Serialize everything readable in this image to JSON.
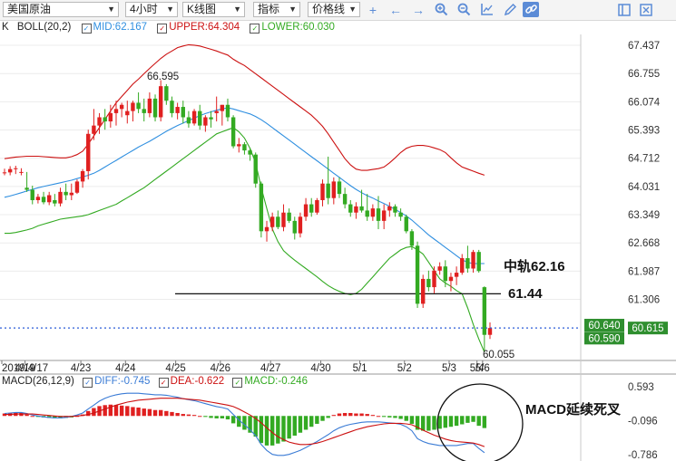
{
  "toolbar": {
    "product": "美国原油",
    "period": "4小时",
    "chart_type": "K线图",
    "indicator": "指标",
    "price_line": "价格线"
  },
  "indicator_bar": {
    "k": "K",
    "boll_label": "BOLL(20,2)",
    "mid": "MID:62.167",
    "upper": "UPPER:64.304",
    "lower": "LOWER:60.030"
  },
  "macd_bar": {
    "label": "MACD(26,12,9)",
    "diff": "DIFF:-0.745",
    "dea": "DEA:-0.622",
    "macd": "MACD:-0.246"
  },
  "colors": {
    "up": "#e02020",
    "down": "#33aa22",
    "mid": "#2f8fe0",
    "upper": "#cc1111",
    "lower": "#33aa22",
    "price_line": "#2a5bd7",
    "diff": "#3a7bd5",
    "dea": "#cc1111",
    "label_bg": "#2f8f2f"
  },
  "annotations": {
    "high_label": "66.595",
    "low_label": "60.055",
    "mid_rail": "中轨62.16",
    "support": "61.44",
    "macd_note": "MACD延续死叉"
  },
  "price_tags": {
    "upper": "60.640",
    "lower": "60.590",
    "current": "60.615"
  },
  "chart_data": {
    "type": "candlestick",
    "price_axis": [
      "67.437",
      "66.755",
      "66.074",
      "65.393",
      "64.712",
      "64.031",
      "63.349",
      "62.668",
      "61.987",
      "61.306",
      "60.625"
    ],
    "macd_axis": [
      "0.593",
      "-0.096",
      "-0.786"
    ],
    "x_labels": [
      "2019/4/17",
      "4/19",
      "4/23",
      "4/24",
      "4/25",
      "4/26",
      "4/27",
      "4/30",
      "5/1",
      "5/2",
      "5/3",
      "5/4",
      "5/6"
    ],
    "ohlc": [
      [
        64.35,
        64.46,
        64.3,
        64.37
      ],
      [
        64.37,
        64.52,
        64.3,
        64.45
      ],
      [
        64.45,
        64.53,
        64.33,
        64.47
      ],
      [
        64.36,
        64.47,
        64.3,
        64.38
      ],
      [
        64.0,
        64.38,
        63.9,
        63.95
      ],
      [
        63.95,
        64.05,
        63.6,
        63.7
      ],
      [
        63.7,
        63.85,
        63.62,
        63.78
      ],
      [
        63.78,
        63.9,
        63.6,
        63.65
      ],
      [
        63.65,
        63.9,
        63.58,
        63.82
      ],
      [
        63.7,
        63.85,
        63.55,
        63.62
      ],
      [
        63.62,
        64.0,
        63.55,
        63.9
      ],
      [
        63.9,
        64.1,
        63.7,
        63.82
      ],
      [
        63.82,
        64.1,
        63.7,
        63.88
      ],
      [
        63.88,
        64.2,
        63.85,
        64.15
      ],
      [
        64.15,
        64.45,
        64.0,
        64.4
      ],
      [
        64.4,
        65.4,
        64.2,
        65.3
      ],
      [
        65.3,
        65.9,
        65.15,
        65.5
      ],
      [
        65.5,
        65.8,
        65.3,
        65.7
      ],
      [
        65.7,
        65.9,
        65.4,
        65.6
      ],
      [
        65.6,
        66.0,
        65.45,
        65.8
      ],
      [
        65.8,
        66.1,
        65.5,
        65.9
      ],
      [
        65.9,
        66.05,
        65.7,
        66.0
      ],
      [
        65.75,
        66.1,
        65.55,
        65.85
      ],
      [
        65.85,
        66.1,
        65.6,
        66.05
      ],
      [
        66.05,
        66.3,
        65.8,
        65.9
      ],
      [
        65.9,
        66.15,
        65.6,
        65.8
      ],
      [
        65.8,
        66.3,
        65.7,
        66.15
      ],
      [
        66.15,
        66.25,
        65.6,
        65.7
      ],
      [
        65.7,
        66.595,
        65.6,
        66.45
      ],
      [
        66.45,
        66.5,
        66.0,
        66.1
      ],
      [
        66.1,
        66.2,
        65.7,
        65.8
      ],
      [
        65.8,
        66.05,
        65.65,
        65.95
      ],
      [
        65.95,
        66.1,
        65.55,
        65.7
      ],
      [
        65.7,
        65.85,
        65.45,
        65.55
      ],
      [
        65.55,
        65.9,
        65.5,
        65.85
      ],
      [
        65.85,
        66.0,
        65.4,
        65.5
      ],
      [
        65.5,
        65.75,
        65.35,
        65.7
      ],
      [
        65.7,
        65.85,
        65.45,
        65.65
      ],
      [
        65.8,
        66.2,
        65.6,
        65.85
      ],
      [
        65.85,
        66.0,
        65.5,
        66.0
      ],
      [
        66.0,
        66.15,
        65.6,
        65.7
      ],
      [
        65.7,
        65.75,
        64.95,
        65.0
      ],
      [
        65.0,
        65.2,
        64.85,
        65.05
      ],
      [
        65.05,
        65.1,
        64.8,
        64.9
      ],
      [
        64.9,
        64.95,
        64.65,
        64.8
      ],
      [
        64.8,
        64.85,
        64.0,
        64.1
      ],
      [
        64.1,
        64.15,
        62.8,
        62.95
      ],
      [
        62.95,
        63.2,
        62.7,
        63.05
      ],
      [
        63.05,
        63.4,
        62.95,
        63.3
      ],
      [
        63.3,
        63.45,
        63.0,
        63.05
      ],
      [
        63.05,
        63.6,
        62.95,
        63.4
      ],
      [
        63.4,
        63.5,
        63.15,
        63.2
      ],
      [
        63.2,
        63.3,
        62.75,
        62.9
      ],
      [
        62.9,
        63.4,
        62.8,
        63.3
      ],
      [
        63.3,
        63.75,
        63.2,
        63.6
      ],
      [
        63.6,
        63.75,
        63.3,
        63.4
      ],
      [
        63.4,
        63.75,
        63.35,
        63.7
      ],
      [
        63.7,
        64.2,
        63.55,
        64.1
      ],
      [
        64.1,
        64.75,
        63.6,
        63.75
      ],
      [
        63.75,
        64.25,
        63.6,
        64.15
      ],
      [
        64.15,
        64.25,
        63.75,
        63.85
      ],
      [
        63.85,
        64.0,
        63.5,
        63.6
      ],
      [
        63.6,
        63.7,
        63.3,
        63.4
      ],
      [
        63.4,
        63.65,
        63.25,
        63.55
      ],
      [
        63.55,
        63.95,
        63.4,
        63.45
      ],
      [
        63.45,
        63.85,
        63.2,
        63.3
      ],
      [
        63.3,
        63.6,
        63.2,
        63.5
      ],
      [
        63.5,
        63.8,
        63.0,
        63.2
      ],
      [
        63.2,
        63.6,
        63.0,
        63.45
      ],
      [
        63.45,
        63.65,
        63.3,
        63.55
      ],
      [
        63.55,
        63.6,
        63.3,
        63.4
      ],
      [
        63.4,
        63.5,
        63.2,
        63.3
      ],
      [
        63.3,
        63.35,
        62.9,
        62.95
      ],
      [
        62.95,
        63.0,
        62.5,
        62.6
      ],
      [
        62.6,
        62.7,
        61.1,
        61.2
      ],
      [
        61.2,
        61.9,
        61.1,
        61.8
      ],
      [
        61.8,
        62.0,
        61.5,
        61.6
      ],
      [
        61.6,
        62.1,
        61.45,
        62.0
      ],
      [
        62.0,
        62.2,
        61.9,
        62.1
      ],
      [
        62.1,
        62.25,
        61.6,
        61.75
      ],
      [
        61.75,
        61.95,
        61.5,
        61.85
      ],
      [
        61.85,
        62.1,
        61.65,
        61.95
      ],
      [
        61.95,
        62.4,
        61.9,
        62.3
      ],
      [
        62.3,
        62.6,
        61.95,
        62.05
      ],
      [
        62.05,
        62.5,
        61.95,
        62.45
      ],
      [
        62.45,
        62.5,
        61.95,
        61.99
      ],
      [
        61.6,
        61.62,
        60.055,
        60.45
      ],
      [
        60.45,
        60.75,
        60.35,
        60.615
      ]
    ],
    "mid": [
      63.77,
      63.8,
      63.84,
      63.88,
      63.92,
      63.96,
      64.0,
      64.03,
      64.06,
      64.09,
      64.12,
      64.15,
      64.18,
      64.22,
      64.26,
      64.3,
      64.35,
      64.42,
      64.5,
      64.58,
      64.66,
      64.74,
      64.82,
      64.9,
      64.98,
      65.05,
      65.12,
      65.2,
      65.28,
      65.36,
      65.43,
      65.5,
      65.56,
      65.62,
      65.68,
      65.74,
      65.79,
      65.83,
      65.87,
      65.9,
      65.93,
      65.9,
      65.86,
      65.82,
      65.78,
      65.72,
      65.64,
      65.55,
      65.45,
      65.35,
      65.25,
      65.15,
      65.05,
      64.95,
      64.85,
      64.75,
      64.65,
      64.55,
      64.45,
      64.35,
      64.25,
      64.15,
      64.05,
      63.96,
      63.88,
      63.81,
      63.75,
      63.68,
      63.62,
      63.55,
      63.48,
      63.4,
      63.32,
      63.22,
      63.1,
      62.98,
      62.86,
      62.76,
      62.66,
      62.56,
      62.46,
      62.36,
      62.26,
      62.2,
      62.167,
      62.17,
      62.17
    ],
    "upper": [
      64.7,
      64.72,
      64.74,
      64.75,
      64.76,
      64.76,
      64.76,
      64.75,
      64.74,
      64.73,
      64.72,
      64.72,
      64.75,
      64.8,
      64.88,
      65.05,
      65.25,
      65.45,
      65.65,
      65.85,
      66.05,
      66.2,
      66.35,
      66.5,
      66.62,
      66.75,
      66.88,
      67.0,
      67.12,
      67.22,
      67.3,
      67.38,
      67.42,
      67.45,
      67.44,
      67.42,
      67.38,
      67.34,
      67.3,
      67.25,
      67.2,
      67.1,
      67.02,
      66.95,
      66.85,
      66.75,
      66.65,
      66.55,
      66.45,
      66.35,
      66.25,
      66.15,
      66.05,
      65.95,
      65.85,
      65.75,
      65.62,
      65.48,
      65.3,
      65.1,
      64.9,
      64.7,
      64.55,
      64.45,
      64.42,
      64.42,
      64.44,
      64.46,
      64.5,
      64.6,
      64.72,
      64.85,
      64.95,
      65.0,
      65.02,
      65.02,
      65.0,
      64.96,
      64.92,
      64.85,
      64.72,
      64.6,
      64.5,
      64.45,
      64.4,
      64.35,
      64.304
    ],
    "lower": [
      62.9,
      62.9,
      62.92,
      62.95,
      62.98,
      63.02,
      63.08,
      63.12,
      63.16,
      63.2,
      63.24,
      63.26,
      63.28,
      63.3,
      63.32,
      63.35,
      63.4,
      63.45,
      63.5,
      63.55,
      63.6,
      63.68,
      63.76,
      63.84,
      63.92,
      64.0,
      64.1,
      64.2,
      64.3,
      64.4,
      64.5,
      64.6,
      64.7,
      64.8,
      64.9,
      65.0,
      65.1,
      65.2,
      65.3,
      65.35,
      65.4,
      65.45,
      65.35,
      65.2,
      64.95,
      64.6,
      64.0,
      63.5,
      63.0,
      62.7,
      62.48,
      62.36,
      62.25,
      62.15,
      62.05,
      61.95,
      61.85,
      61.74,
      61.64,
      61.56,
      61.5,
      61.45,
      61.42,
      61.45,
      61.55,
      61.7,
      61.85,
      62.0,
      62.15,
      62.3,
      62.4,
      62.5,
      62.56,
      62.58,
      62.5,
      62.4,
      62.2,
      62.0,
      61.8,
      61.7,
      61.62,
      61.52,
      61.44,
      61.1,
      60.7,
      60.35,
      60.03
    ],
    "macd_hist": [
      0.05,
      0.06,
      0.07,
      0.06,
      0.03,
      0.0,
      -0.02,
      -0.03,
      -0.04,
      -0.05,
      -0.05,
      -0.04,
      -0.03,
      0.0,
      0.03,
      0.1,
      0.16,
      0.2,
      0.22,
      0.23,
      0.22,
      0.21,
      0.2,
      0.18,
      0.17,
      0.15,
      0.14,
      0.12,
      0.12,
      0.1,
      0.08,
      0.06,
      0.04,
      0.03,
      0.02,
      0.0,
      -0.02,
      -0.04,
      -0.05,
      -0.05,
      -0.07,
      -0.15,
      -0.22,
      -0.28,
      -0.34,
      -0.42,
      -0.55,
      -0.6,
      -0.6,
      -0.56,
      -0.52,
      -0.46,
      -0.4,
      -0.34,
      -0.28,
      -0.22,
      -0.16,
      -0.1,
      -0.04,
      0.02,
      0.05,
      0.06,
      0.06,
      0.05,
      0.05,
      0.04,
      0.02,
      0.0,
      -0.02,
      -0.03,
      -0.04,
      -0.06,
      -0.1,
      -0.16,
      -0.28,
      -0.3,
      -0.3,
      -0.28,
      -0.26,
      -0.24,
      -0.22,
      -0.2,
      -0.17,
      -0.14,
      -0.12,
      -0.2,
      -0.246
    ],
    "diff": [
      0.05,
      0.06,
      0.07,
      0.07,
      0.05,
      0.02,
      0.0,
      -0.02,
      -0.03,
      -0.04,
      -0.04,
      -0.03,
      -0.01,
      0.02,
      0.06,
      0.14,
      0.22,
      0.3,
      0.36,
      0.4,
      0.43,
      0.45,
      0.46,
      0.46,
      0.46,
      0.45,
      0.44,
      0.43,
      0.43,
      0.42,
      0.4,
      0.38,
      0.35,
      0.33,
      0.31,
      0.28,
      0.25,
      0.22,
      0.19,
      0.17,
      0.14,
      0.03,
      -0.08,
      -0.18,
      -0.28,
      -0.4,
      -0.58,
      -0.7,
      -0.78,
      -0.8,
      -0.8,
      -0.78,
      -0.74,
      -0.7,
      -0.64,
      -0.58,
      -0.52,
      -0.45,
      -0.38,
      -0.3,
      -0.24,
      -0.2,
      -0.17,
      -0.15,
      -0.13,
      -0.12,
      -0.12,
      -0.12,
      -0.13,
      -0.14,
      -0.15,
      -0.17,
      -0.22,
      -0.3,
      -0.46,
      -0.52,
      -0.56,
      -0.58,
      -0.6,
      -0.6,
      -0.6,
      -0.6,
      -0.58,
      -0.56,
      -0.56,
      -0.66,
      -0.745
    ],
    "dea": [
      0.03,
      0.03,
      0.04,
      0.04,
      0.04,
      0.04,
      0.03,
      0.02,
      0.01,
      0.0,
      -0.01,
      -0.01,
      -0.01,
      0.0,
      0.01,
      0.03,
      0.06,
      0.1,
      0.14,
      0.18,
      0.22,
      0.25,
      0.28,
      0.3,
      0.32,
      0.33,
      0.34,
      0.35,
      0.36,
      0.36,
      0.36,
      0.36,
      0.35,
      0.34,
      0.33,
      0.32,
      0.3,
      0.28,
      0.26,
      0.24,
      0.22,
      0.19,
      0.14,
      0.08,
      0.02,
      -0.05,
      -0.14,
      -0.24,
      -0.34,
      -0.42,
      -0.48,
      -0.53,
      -0.56,
      -0.58,
      -0.58,
      -0.57,
      -0.55,
      -0.52,
      -0.48,
      -0.44,
      -0.4,
      -0.36,
      -0.32,
      -0.28,
      -0.25,
      -0.22,
      -0.2,
      -0.18,
      -0.16,
      -0.15,
      -0.15,
      -0.15,
      -0.16,
      -0.18,
      -0.23,
      -0.29,
      -0.34,
      -0.39,
      -0.43,
      -0.47,
      -0.5,
      -0.52,
      -0.53,
      -0.54,
      -0.55,
      -0.58,
      -0.622
    ]
  }
}
